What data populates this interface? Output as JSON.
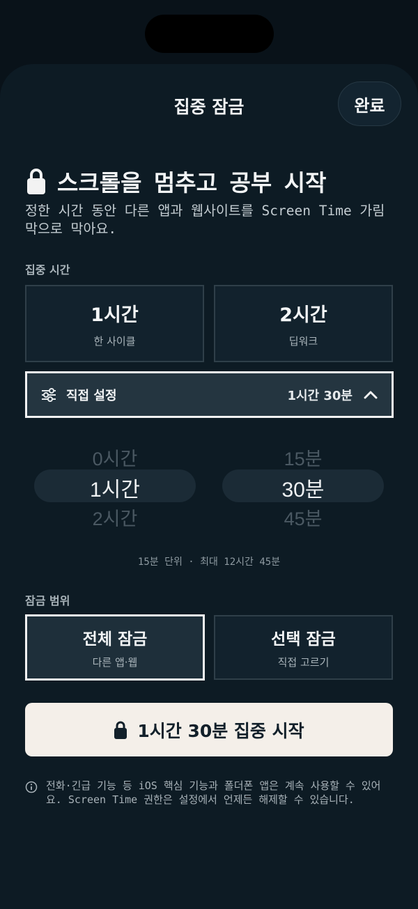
{
  "sheet": {
    "title": "집중 잠금",
    "done_label": "완료"
  },
  "hero": {
    "icon": "lock-icon",
    "title": "스크롤을 멈추고 공부 시작",
    "description": "정한 시간 동안 다른 앱과 웹사이트를 Screen Time 가림막으로 막아요."
  },
  "focus_time": {
    "label": "집중 시간",
    "presets": [
      {
        "title": "1시간",
        "subtitle": "한 사이클"
      },
      {
        "title": "2시간",
        "subtitle": "딥워크"
      }
    ],
    "custom": {
      "icon": "sliders-icon",
      "label": "직접 설정",
      "value": "1시간 30분",
      "chevron": "chevron-up-icon"
    },
    "picker": {
      "hours": [
        "0시간",
        "1시간",
        "2시간"
      ],
      "minutes": [
        "15분",
        "30분",
        "45분"
      ],
      "selected_hours": "1시간",
      "selected_minutes": "30분"
    },
    "hint": "15분 단위 · 최대 12시간 45분"
  },
  "lock_scope": {
    "label": "잠금 범위",
    "options": [
      {
        "title": "전체 잠금",
        "subtitle": "다른 앱·웹",
        "selected": true
      },
      {
        "title": "선택 잠금",
        "subtitle": "직접 고르기",
        "selected": false
      }
    ]
  },
  "start_button": {
    "icon": "lock-icon",
    "label": "1시간 30분 집중 시작"
  },
  "footer_note": {
    "icon": "info-icon",
    "text": "전화·긴급 기능 등 iOS 핵심 기능과 폴더폰 앱은 계속 사용할 수 있어요. Screen Time 권한은 설정에서 언제든 해제할 수 있습니다."
  },
  "colors": {
    "background": "#091219",
    "sheet": "#0d1b24",
    "accent_button": "#f4efe9",
    "selected_border": "#f2f2f2"
  }
}
